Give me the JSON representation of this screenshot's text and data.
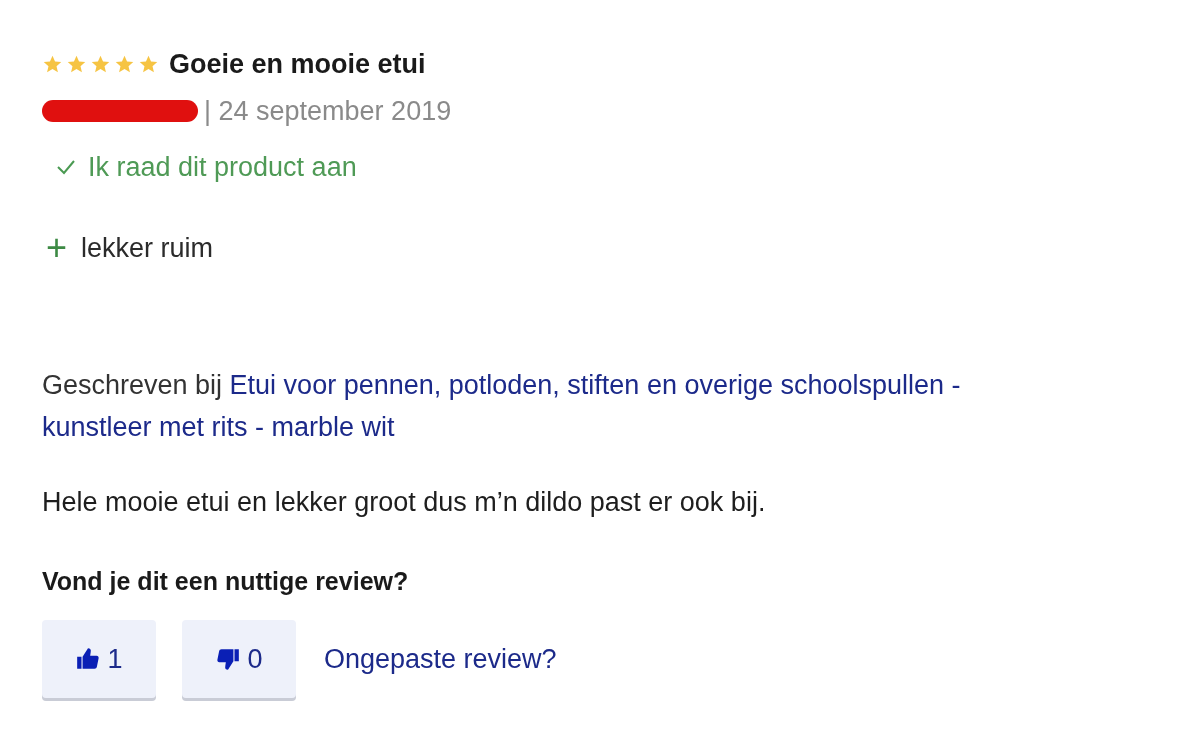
{
  "review": {
    "stars": 5,
    "title": "Goeie en mooie etui",
    "date": "| 24 september 2019",
    "recommended": true,
    "recommend_text": "Ik raad dit product aan",
    "pros": [
      {
        "sign": "+",
        "text": "lekker ruim"
      }
    ],
    "written_for": {
      "prefix": "Geschreven bij",
      "link_lines": [
        "Etui voor pennen, potloden, stiften en overige schoolspullen -",
        "kunstleer met rits - marble wit"
      ]
    },
    "body": "Hele mooie etui en lekker groot dus m’n dildo past er ook bij.",
    "helpful_question": "Vond je dit een nuttige review?",
    "votes": [
      {
        "kind": "up",
        "count": "1"
      },
      {
        "kind": "down",
        "count": "0"
      }
    ],
    "report_link": "Ongepaste review?"
  }
}
